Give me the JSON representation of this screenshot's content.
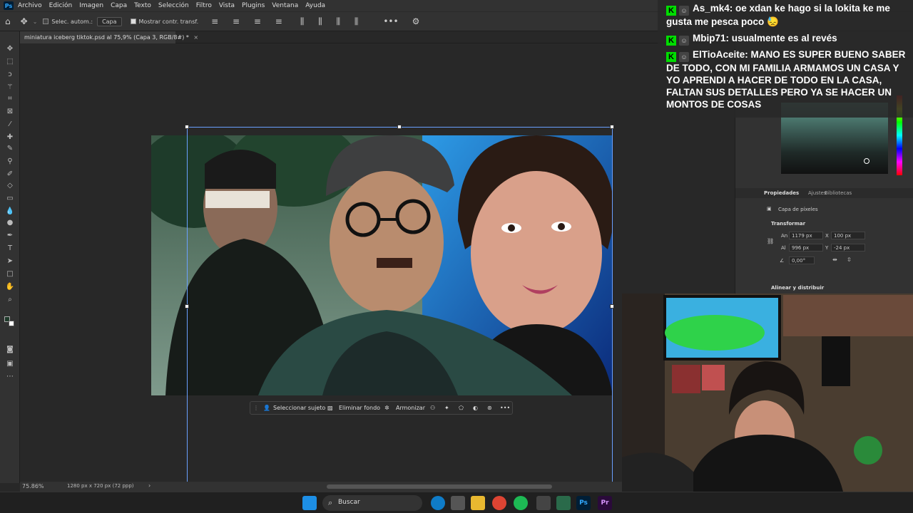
{
  "app": {
    "logo": "Ps"
  },
  "menu": [
    "Archivo",
    "Edición",
    "Imagen",
    "Capa",
    "Texto",
    "Selección",
    "Filtro",
    "Vista",
    "Plugins",
    "Ventana",
    "Ayuda"
  ],
  "options": {
    "auto_select_label": "Selec. autom.:",
    "auto_select_value": "Capa",
    "show_transform_label": "Mostrar contr. transf."
  },
  "document_tab": {
    "title": "miniatura iceberg tiktok.psd al 75,9% (Capa 3, RGB/8#) *",
    "close": "×"
  },
  "status": {
    "zoom": "75.86%",
    "doc_info": "1280 px x 720 px (72 ppp)",
    "arrow": "›"
  },
  "context_bar": {
    "select_subject": "Seleccionar sujeto",
    "remove_bg": "Eliminar fondo",
    "harmonize": "Armonizar",
    "more": "•••"
  },
  "right_panel": {
    "tabs": [
      "Propiedades",
      "Ajustes",
      "Bibliotecas"
    ],
    "layer_type": "Capa de píxeles",
    "transform_title": "Transformar",
    "w_label": "An",
    "w_value": "1179 px",
    "x_label": "X",
    "x_value": "100 px",
    "h_label": "Al",
    "h_value": "996 px",
    "y_label": "Y",
    "y_value": "-24 px",
    "angle_value": "0,00°",
    "align_title": "Alinear y distribuir"
  },
  "chat": [
    {
      "user": "As_mk4:",
      "text": "oe xdan ke hago si la lokita ke me gusta me pesca poco 😓"
    },
    {
      "user": "Mbip71:",
      "text": "usualmente es al revés"
    },
    {
      "user": "ElTioAceite:",
      "text": "MANO ES SUPER BUENO SABER DE TODO, CON MI FAMILIA ARMAMOS UN CASA Y YO APRENDI A HACER DE TODO EN LA CASA, FALTAN SUS DETALLES PERO YA SE HACER UN MONTOS DE COSAS"
    }
  ],
  "taskbar": {
    "search": "Buscar",
    "ps_label": "Ps",
    "pr_label": "Pr"
  },
  "colors": {
    "accent": "#31a8ff",
    "kick_green": "#00dd00"
  }
}
